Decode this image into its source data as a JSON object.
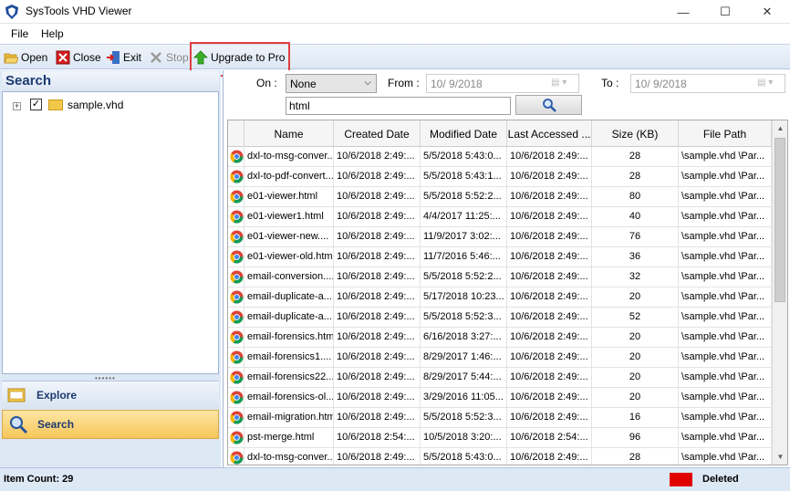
{
  "window": {
    "title": "SysTools VHD Viewer",
    "minimize": "—",
    "maximize": "☐",
    "close": "✕"
  },
  "menu": {
    "file": "File",
    "help": "Help"
  },
  "toolbar": {
    "open": "Open",
    "close": "Close",
    "exit": "Exit",
    "stop": "Stop",
    "upgrade": "Upgrade to Pro"
  },
  "left": {
    "search_header": "Search",
    "tree_item": "sample.vhd",
    "tree_checked": true,
    "splitter": "••••••",
    "nav_explore": "Explore",
    "nav_search": "Search"
  },
  "filters": {
    "on_label": "On :",
    "on_value": "None",
    "from_label": "From :",
    "from_value": "10/  9/2018",
    "to_label": "To :",
    "to_value": "10/  9/2018",
    "search_value": "html"
  },
  "grid": {
    "columns": [
      "Name",
      "Created Date",
      "Modified Date",
      "Last Accessed ...",
      "Size (KB)",
      "File Path"
    ],
    "rows": [
      [
        "dxl-to-msg-conver...",
        "10/6/2018 2:49:...",
        "5/5/2018 5:43:0...",
        "10/6/2018 2:49:...",
        "28",
        "\\sample.vhd  \\Par..."
      ],
      [
        "dxl-to-pdf-convert...",
        "10/6/2018 2:49:...",
        "5/5/2018 5:43:1...",
        "10/6/2018 2:49:...",
        "28",
        "\\sample.vhd  \\Par..."
      ],
      [
        "e01-viewer.html",
        "10/6/2018 2:49:...",
        "5/5/2018 5:52:2...",
        "10/6/2018 2:49:...",
        "80",
        "\\sample.vhd  \\Par..."
      ],
      [
        "e01-viewer1.html",
        "10/6/2018 2:49:...",
        "4/4/2017 11:25:...",
        "10/6/2018 2:49:...",
        "40",
        "\\sample.vhd  \\Par..."
      ],
      [
        "e01-viewer-new....",
        "10/6/2018 2:49:...",
        "11/9/2017 3:02:...",
        "10/6/2018 2:49:...",
        "76",
        "\\sample.vhd  \\Par..."
      ],
      [
        "e01-viewer-old.html",
        "10/6/2018 2:49:...",
        "11/7/2016 5:46:...",
        "10/6/2018 2:49:...",
        "36",
        "\\sample.vhd  \\Par..."
      ],
      [
        "email-conversion....",
        "10/6/2018 2:49:...",
        "5/5/2018 5:52:2...",
        "10/6/2018 2:49:...",
        "32",
        "\\sample.vhd  \\Par..."
      ],
      [
        "email-duplicate-a...",
        "10/6/2018 2:49:...",
        "5/17/2018 10:23...",
        "10/6/2018 2:49:...",
        "20",
        "\\sample.vhd  \\Par..."
      ],
      [
        "email-duplicate-a...",
        "10/6/2018 2:49:...",
        "5/5/2018 5:52:3...",
        "10/6/2018 2:49:...",
        "52",
        "\\sample.vhd  \\Par..."
      ],
      [
        "email-forensics.html",
        "10/6/2018 2:49:...",
        "6/16/2018 3:27:...",
        "10/6/2018 2:49:...",
        "20",
        "\\sample.vhd  \\Par..."
      ],
      [
        "email-forensics1....",
        "10/6/2018 2:49:...",
        "8/29/2017 1:46:...",
        "10/6/2018 2:49:...",
        "20",
        "\\sample.vhd  \\Par..."
      ],
      [
        "email-forensics22...",
        "10/6/2018 2:49:...",
        "8/29/2017 5:44:...",
        "10/6/2018 2:49:...",
        "20",
        "\\sample.vhd  \\Par..."
      ],
      [
        "email-forensics-ol...",
        "10/6/2018 2:49:...",
        "3/29/2016 11:05...",
        "10/6/2018 2:49:...",
        "20",
        "\\sample.vhd  \\Par..."
      ],
      [
        "email-migration.html",
        "10/6/2018 2:49:...",
        "5/5/2018 5:52:3...",
        "10/6/2018 2:49:...",
        "16",
        "\\sample.vhd  \\Par..."
      ],
      [
        "pst-merge.html",
        "10/6/2018 2:54:...",
        "10/5/2018 3:20:...",
        "10/6/2018 2:54:...",
        "96",
        "\\sample.vhd  \\Par..."
      ],
      [
        "dxl-to-msg-conver...",
        "10/6/2018 2:49:...",
        "5/5/2018 5:43:0...",
        "10/6/2018 2:49:...",
        "28",
        "\\sample.vhd  \\Par..."
      ]
    ]
  },
  "status": {
    "item_count": "Item Count: 29",
    "deleted": "Deleted",
    "deleted_color": "#e00000"
  },
  "icons": {
    "open": "folder-open-icon",
    "close": "red-x-icon",
    "exit": "exit-door-icon",
    "stop": "stop-icon",
    "upgrade": "green-up-arrow-icon",
    "file_row": "chrome-html-icon"
  }
}
